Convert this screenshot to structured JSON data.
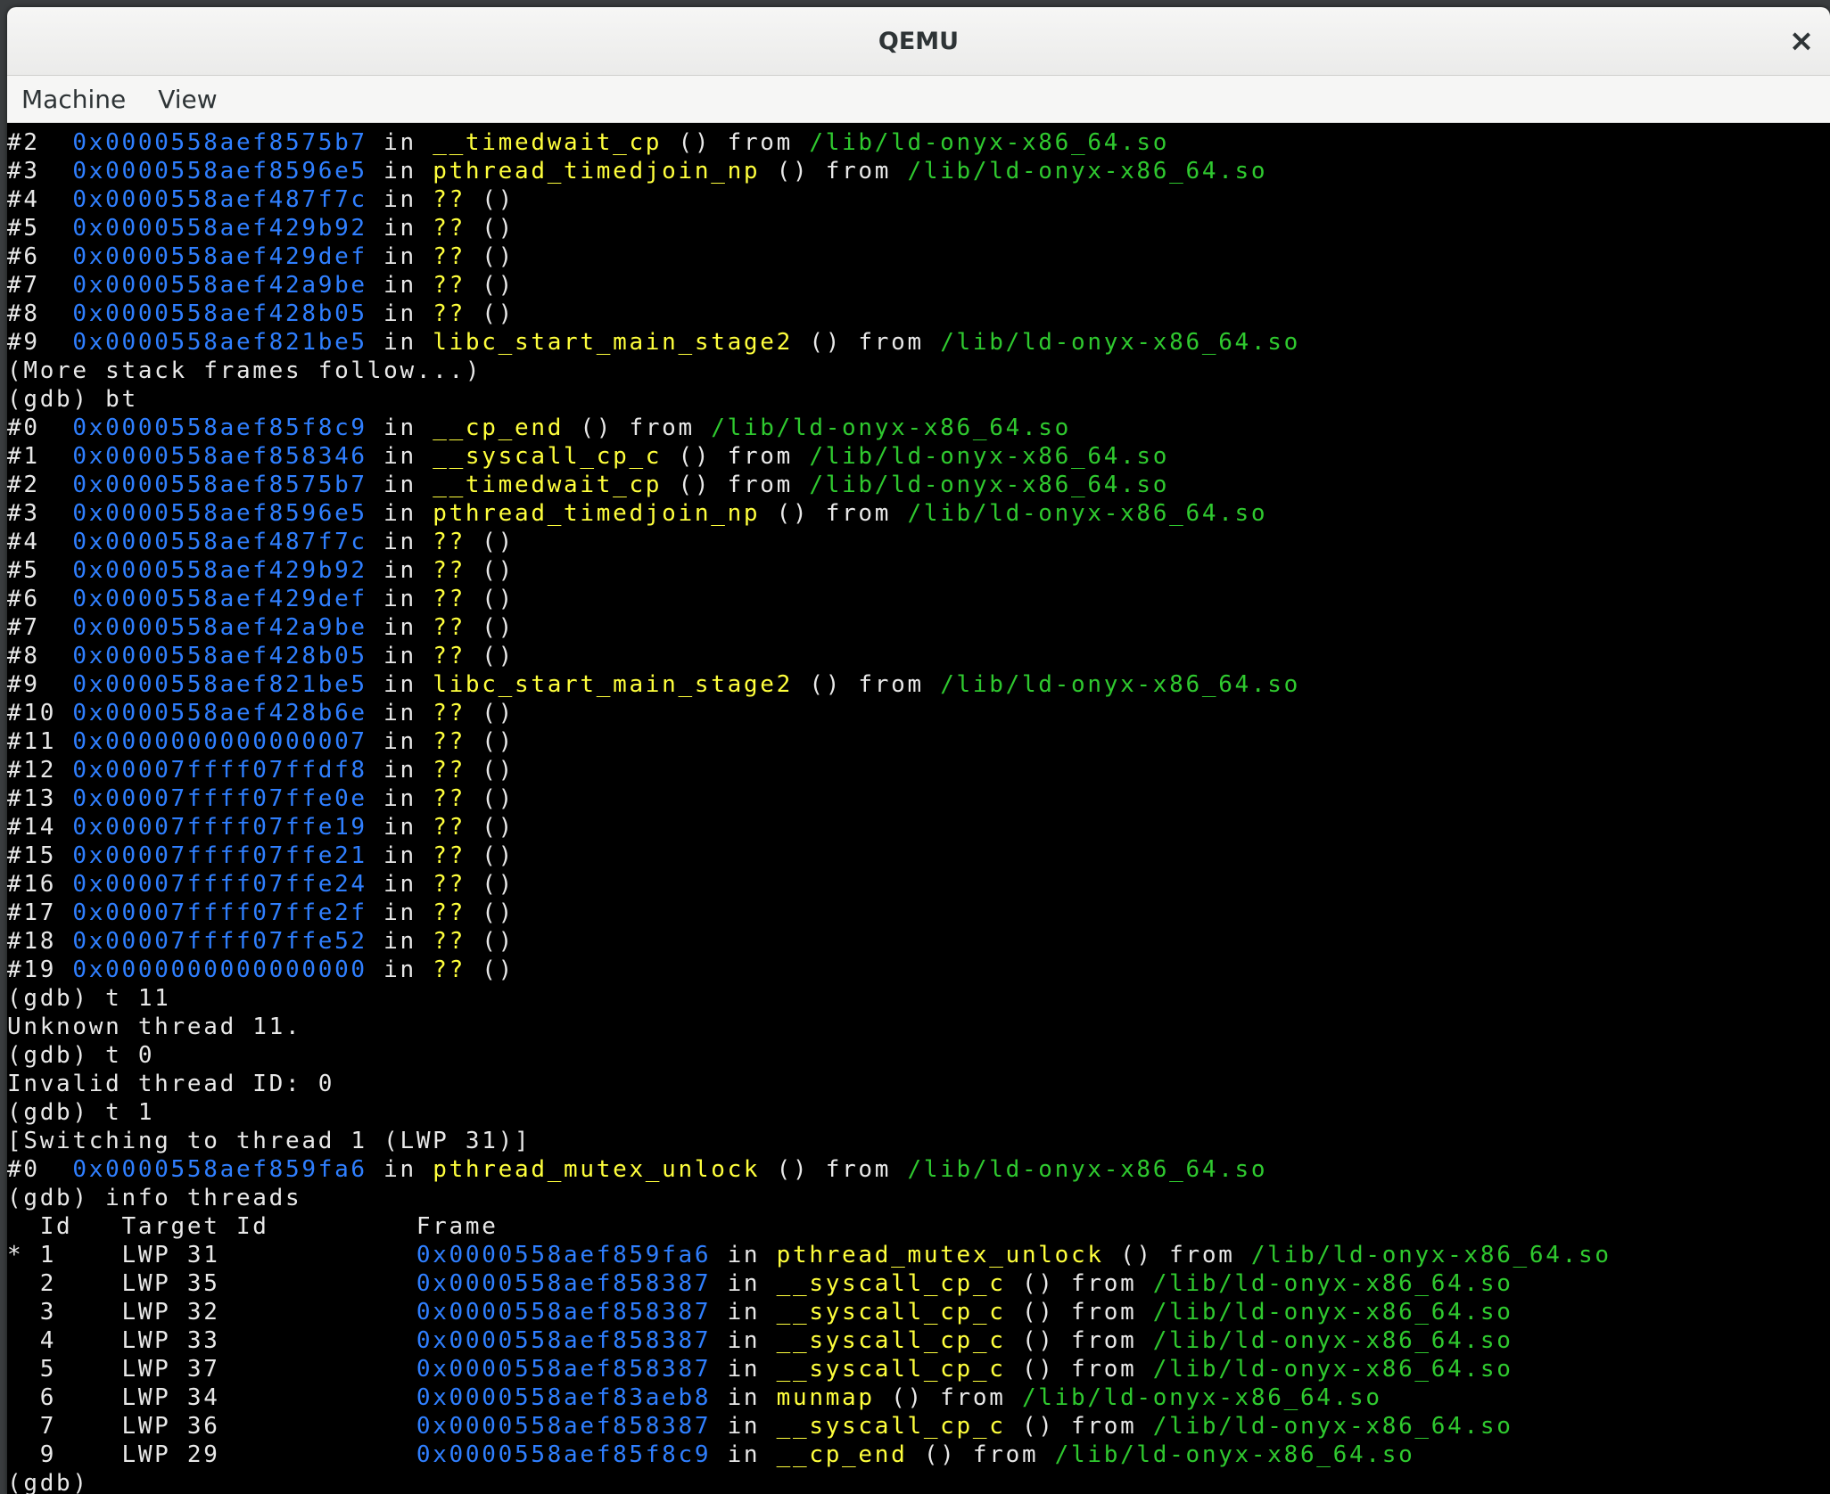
{
  "window": {
    "title": "QEMU",
    "close_glyph": "×"
  },
  "menubar": {
    "items": [
      "Machine",
      "View"
    ]
  },
  "colors": {
    "address": "#2f7fff",
    "function": "#ffff3c",
    "path": "#2fc92f",
    "text": "#e8e8e8"
  },
  "terminal": {
    "lines": [
      [
        [
          "p",
          "#2  "
        ],
        [
          "a",
          "0x0000558aef8575b7"
        ],
        [
          "p",
          " in "
        ],
        [
          "f",
          "__timedwait_cp"
        ],
        [
          "p",
          " () from "
        ],
        [
          "s",
          "/lib/ld-onyx-x86_64.so"
        ]
      ],
      [
        [
          "p",
          "#3  "
        ],
        [
          "a",
          "0x0000558aef8596e5"
        ],
        [
          "p",
          " in "
        ],
        [
          "f",
          "pthread_timedjoin_np"
        ],
        [
          "p",
          " () from "
        ],
        [
          "s",
          "/lib/ld-onyx-x86_64.so"
        ]
      ],
      [
        [
          "p",
          "#4  "
        ],
        [
          "a",
          "0x0000558aef487f7c"
        ],
        [
          "p",
          " in "
        ],
        [
          "f",
          "??"
        ],
        [
          "p",
          " ()"
        ]
      ],
      [
        [
          "p",
          "#5  "
        ],
        [
          "a",
          "0x0000558aef429b92"
        ],
        [
          "p",
          " in "
        ],
        [
          "f",
          "??"
        ],
        [
          "p",
          " ()"
        ]
      ],
      [
        [
          "p",
          "#6  "
        ],
        [
          "a",
          "0x0000558aef429def"
        ],
        [
          "p",
          " in "
        ],
        [
          "f",
          "??"
        ],
        [
          "p",
          " ()"
        ]
      ],
      [
        [
          "p",
          "#7  "
        ],
        [
          "a",
          "0x0000558aef42a9be"
        ],
        [
          "p",
          " in "
        ],
        [
          "f",
          "??"
        ],
        [
          "p",
          " ()"
        ]
      ],
      [
        [
          "p",
          "#8  "
        ],
        [
          "a",
          "0x0000558aef428b05"
        ],
        [
          "p",
          " in "
        ],
        [
          "f",
          "??"
        ],
        [
          "p",
          " ()"
        ]
      ],
      [
        [
          "p",
          "#9  "
        ],
        [
          "a",
          "0x0000558aef821be5"
        ],
        [
          "p",
          " in "
        ],
        [
          "f",
          "libc_start_main_stage2"
        ],
        [
          "p",
          " () from "
        ],
        [
          "s",
          "/lib/ld-onyx-x86_64.so"
        ]
      ],
      [
        [
          "p",
          "(More stack frames follow...)"
        ]
      ],
      [
        [
          "p",
          "(gdb) bt"
        ]
      ],
      [
        [
          "p",
          "#0  "
        ],
        [
          "a",
          "0x0000558aef85f8c9"
        ],
        [
          "p",
          " in "
        ],
        [
          "f",
          "__cp_end"
        ],
        [
          "p",
          " () from "
        ],
        [
          "s",
          "/lib/ld-onyx-x86_64.so"
        ]
      ],
      [
        [
          "p",
          "#1  "
        ],
        [
          "a",
          "0x0000558aef858346"
        ],
        [
          "p",
          " in "
        ],
        [
          "f",
          "__syscall_cp_c"
        ],
        [
          "p",
          " () from "
        ],
        [
          "s",
          "/lib/ld-onyx-x86_64.so"
        ]
      ],
      [
        [
          "p",
          "#2  "
        ],
        [
          "a",
          "0x0000558aef8575b7"
        ],
        [
          "p",
          " in "
        ],
        [
          "f",
          "__timedwait_cp"
        ],
        [
          "p",
          " () from "
        ],
        [
          "s",
          "/lib/ld-onyx-x86_64.so"
        ]
      ],
      [
        [
          "p",
          "#3  "
        ],
        [
          "a",
          "0x0000558aef8596e5"
        ],
        [
          "p",
          " in "
        ],
        [
          "f",
          "pthread_timedjoin_np"
        ],
        [
          "p",
          " () from "
        ],
        [
          "s",
          "/lib/ld-onyx-x86_64.so"
        ]
      ],
      [
        [
          "p",
          "#4  "
        ],
        [
          "a",
          "0x0000558aef487f7c"
        ],
        [
          "p",
          " in "
        ],
        [
          "f",
          "??"
        ],
        [
          "p",
          " ()"
        ]
      ],
      [
        [
          "p",
          "#5  "
        ],
        [
          "a",
          "0x0000558aef429b92"
        ],
        [
          "p",
          " in "
        ],
        [
          "f",
          "??"
        ],
        [
          "p",
          " ()"
        ]
      ],
      [
        [
          "p",
          "#6  "
        ],
        [
          "a",
          "0x0000558aef429def"
        ],
        [
          "p",
          " in "
        ],
        [
          "f",
          "??"
        ],
        [
          "p",
          " ()"
        ]
      ],
      [
        [
          "p",
          "#7  "
        ],
        [
          "a",
          "0x0000558aef42a9be"
        ],
        [
          "p",
          " in "
        ],
        [
          "f",
          "??"
        ],
        [
          "p",
          " ()"
        ]
      ],
      [
        [
          "p",
          "#8  "
        ],
        [
          "a",
          "0x0000558aef428b05"
        ],
        [
          "p",
          " in "
        ],
        [
          "f",
          "??"
        ],
        [
          "p",
          " ()"
        ]
      ],
      [
        [
          "p",
          "#9  "
        ],
        [
          "a",
          "0x0000558aef821be5"
        ],
        [
          "p",
          " in "
        ],
        [
          "f",
          "libc_start_main_stage2"
        ],
        [
          "p",
          " () from "
        ],
        [
          "s",
          "/lib/ld-onyx-x86_64.so"
        ]
      ],
      [
        [
          "p",
          "#10 "
        ],
        [
          "a",
          "0x0000558aef428b6e"
        ],
        [
          "p",
          " in "
        ],
        [
          "f",
          "??"
        ],
        [
          "p",
          " ()"
        ]
      ],
      [
        [
          "p",
          "#11 "
        ],
        [
          "a",
          "0x0000000000000007"
        ],
        [
          "p",
          " in "
        ],
        [
          "f",
          "??"
        ],
        [
          "p",
          " ()"
        ]
      ],
      [
        [
          "p",
          "#12 "
        ],
        [
          "a",
          "0x00007ffff07ffdf8"
        ],
        [
          "p",
          " in "
        ],
        [
          "f",
          "??"
        ],
        [
          "p",
          " ()"
        ]
      ],
      [
        [
          "p",
          "#13 "
        ],
        [
          "a",
          "0x00007ffff07ffe0e"
        ],
        [
          "p",
          " in "
        ],
        [
          "f",
          "??"
        ],
        [
          "p",
          " ()"
        ]
      ],
      [
        [
          "p",
          "#14 "
        ],
        [
          "a",
          "0x00007ffff07ffe19"
        ],
        [
          "p",
          " in "
        ],
        [
          "f",
          "??"
        ],
        [
          "p",
          " ()"
        ]
      ],
      [
        [
          "p",
          "#15 "
        ],
        [
          "a",
          "0x00007ffff07ffe21"
        ],
        [
          "p",
          " in "
        ],
        [
          "f",
          "??"
        ],
        [
          "p",
          " ()"
        ]
      ],
      [
        [
          "p",
          "#16 "
        ],
        [
          "a",
          "0x00007ffff07ffe24"
        ],
        [
          "p",
          " in "
        ],
        [
          "f",
          "??"
        ],
        [
          "p",
          " ()"
        ]
      ],
      [
        [
          "p",
          "#17 "
        ],
        [
          "a",
          "0x00007ffff07ffe2f"
        ],
        [
          "p",
          " in "
        ],
        [
          "f",
          "??"
        ],
        [
          "p",
          " ()"
        ]
      ],
      [
        [
          "p",
          "#18 "
        ],
        [
          "a",
          "0x00007ffff07ffe52"
        ],
        [
          "p",
          " in "
        ],
        [
          "f",
          "??"
        ],
        [
          "p",
          " ()"
        ]
      ],
      [
        [
          "p",
          "#19 "
        ],
        [
          "a",
          "0x0000000000000000"
        ],
        [
          "p",
          " in "
        ],
        [
          "f",
          "??"
        ],
        [
          "p",
          " ()"
        ]
      ],
      [
        [
          "p",
          "(gdb) t 11"
        ]
      ],
      [
        [
          "p",
          "Unknown thread 11."
        ]
      ],
      [
        [
          "p",
          "(gdb) t 0"
        ]
      ],
      [
        [
          "p",
          "Invalid thread ID: 0"
        ]
      ],
      [
        [
          "p",
          "(gdb) t 1"
        ]
      ],
      [
        [
          "p",
          "[Switching to thread 1 (LWP 31)]"
        ]
      ],
      [
        [
          "p",
          "#0  "
        ],
        [
          "a",
          "0x0000558aef859fa6"
        ],
        [
          "p",
          " in "
        ],
        [
          "f",
          "pthread_mutex_unlock"
        ],
        [
          "p",
          " () from "
        ],
        [
          "s",
          "/lib/ld-onyx-x86_64.so"
        ]
      ],
      [
        [
          "p",
          "(gdb) info threads"
        ]
      ],
      [
        [
          "p",
          "  Id   Target Id         Frame"
        ]
      ],
      [
        [
          "p",
          "* 1    LWP 31            "
        ],
        [
          "a",
          "0x0000558aef859fa6"
        ],
        [
          "p",
          " in "
        ],
        [
          "f",
          "pthread_mutex_unlock"
        ],
        [
          "p",
          " () from "
        ],
        [
          "s",
          "/lib/ld-onyx-x86_64.so"
        ]
      ],
      [
        [
          "p",
          "  2    LWP 35            "
        ],
        [
          "a",
          "0x0000558aef858387"
        ],
        [
          "p",
          " in "
        ],
        [
          "f",
          "__syscall_cp_c"
        ],
        [
          "p",
          " () from "
        ],
        [
          "s",
          "/lib/ld-onyx-x86_64.so"
        ]
      ],
      [
        [
          "p",
          "  3    LWP 32            "
        ],
        [
          "a",
          "0x0000558aef858387"
        ],
        [
          "p",
          " in "
        ],
        [
          "f",
          "__syscall_cp_c"
        ],
        [
          "p",
          " () from "
        ],
        [
          "s",
          "/lib/ld-onyx-x86_64.so"
        ]
      ],
      [
        [
          "p",
          "  4    LWP 33            "
        ],
        [
          "a",
          "0x0000558aef858387"
        ],
        [
          "p",
          " in "
        ],
        [
          "f",
          "__syscall_cp_c"
        ],
        [
          "p",
          " () from "
        ],
        [
          "s",
          "/lib/ld-onyx-x86_64.so"
        ]
      ],
      [
        [
          "p",
          "  5    LWP 37            "
        ],
        [
          "a",
          "0x0000558aef858387"
        ],
        [
          "p",
          " in "
        ],
        [
          "f",
          "__syscall_cp_c"
        ],
        [
          "p",
          " () from "
        ],
        [
          "s",
          "/lib/ld-onyx-x86_64.so"
        ]
      ],
      [
        [
          "p",
          "  6    LWP 34            "
        ],
        [
          "a",
          "0x0000558aef83aeb8"
        ],
        [
          "p",
          " in "
        ],
        [
          "f",
          "munmap"
        ],
        [
          "p",
          " () from "
        ],
        [
          "s",
          "/lib/ld-onyx-x86_64.so"
        ]
      ],
      [
        [
          "p",
          "  7    LWP 36            "
        ],
        [
          "a",
          "0x0000558aef858387"
        ],
        [
          "p",
          " in "
        ],
        [
          "f",
          "__syscall_cp_c"
        ],
        [
          "p",
          " () from "
        ],
        [
          "s",
          "/lib/ld-onyx-x86_64.so"
        ]
      ],
      [
        [
          "p",
          "  9    LWP 29            "
        ],
        [
          "a",
          "0x0000558aef85f8c9"
        ],
        [
          "p",
          " in "
        ],
        [
          "f",
          "__cp_end"
        ],
        [
          "p",
          " () from "
        ],
        [
          "s",
          "/lib/ld-onyx-x86_64.so"
        ]
      ],
      [
        [
          "p",
          "(gdb) "
        ],
        [
          "c",
          "_"
        ]
      ]
    ]
  }
}
